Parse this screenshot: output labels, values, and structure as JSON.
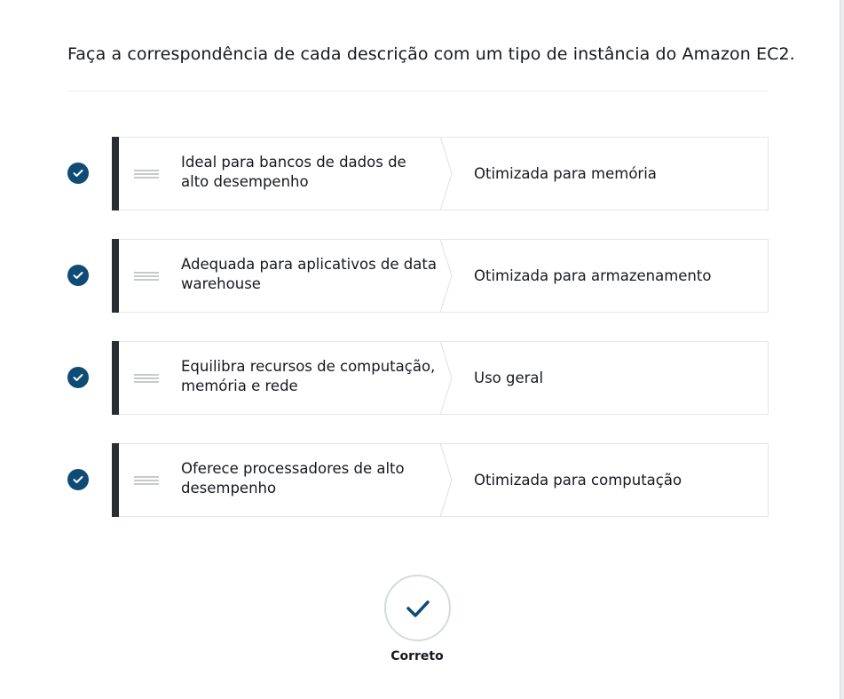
{
  "question": "Faça a correspondência de cada descrição com um tipo de instância do Amazon EC2.",
  "matches": [
    {
      "description": "Ideal para bancos de dados de alto desempenho",
      "answer": "Otimizada para memória"
    },
    {
      "description": "Adequada para aplicativos de data warehouse",
      "answer": "Otimizada para armazenamento"
    },
    {
      "description": "Equilibra recursos de computação, memória e rede",
      "answer": "Uso geral"
    },
    {
      "description": "Oferece processadores de alto desempenho",
      "answer": "Otimizada para computação"
    }
  ],
  "result": {
    "label": "Correto"
  },
  "colors": {
    "check": "#0f4c75",
    "bar": "#2a2e33",
    "border": "#e3e6e6"
  },
  "icons": {
    "row_status": "check-circle-icon",
    "drag": "drag-handle-icon",
    "result": "checkmark-icon"
  }
}
